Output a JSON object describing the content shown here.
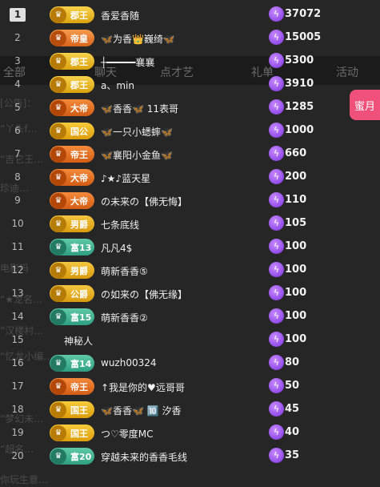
{
  "background": {
    "tabs": [
      "全部",
      "聊天",
      "点才艺",
      "礼单",
      "活动"
    ],
    "side_button": "蜜月",
    "faded_lines": [
      "[公告]：",
      "“丫头f…",
      "“吉它王…",
      "珍迪…",
      "电影吗",
      "“★龙名…",
      "“汉楼村…",
      "“忆龙小编…",
      "“梦幻未…",
      "“超名…",
      "你玩生意…"
    ]
  },
  "ranking": [
    {
      "rank": "1",
      "tier": "郡王",
      "tier_class": "t-junwang",
      "name": "香爱香随",
      "score": "37072"
    },
    {
      "rank": "2",
      "tier": "帝皇",
      "tier_class": "t-diwang",
      "name": "🦋为香👑巍绮🦋",
      "score": "15005"
    },
    {
      "rank": "3",
      "tier": "郡王",
      "tier_class": "t-junwang",
      "name": "┼━━━━━襄襄",
      "score": "5300"
    },
    {
      "rank": "4",
      "tier": "郡王",
      "tier_class": "t-junwang",
      "name": "a、min",
      "score": "3910"
    },
    {
      "rank": "5",
      "tier": "大帝",
      "tier_class": "t-dadi",
      "name": "🦋香香🦋 11表哥",
      "score": "1285"
    },
    {
      "rank": "6",
      "tier": "国公",
      "tier_class": "t-guowang",
      "name": "🦋一只小蟋蟀🦋",
      "score": "1000"
    },
    {
      "rank": "7",
      "tier": "帝王",
      "tier_class": "t-dadi",
      "name": "🦋襄阳小金鱼🦋",
      "score": "660"
    },
    {
      "rank": "8",
      "tier": "大帝",
      "tier_class": "t-dadi",
      "name": "♪★♪蓝天星",
      "score": "200"
    },
    {
      "rank": "9",
      "tier": "大帝",
      "tier_class": "t-dadi",
      "name": "の未来の【佛无悔】",
      "score": "110"
    },
    {
      "rank": "10",
      "tier": "男爵",
      "tier_class": "t-gongjue",
      "name": "七条底线",
      "score": "105"
    },
    {
      "rank": "11",
      "tier": "富13",
      "tier_class": "t-fu",
      "name": "凡凡4$",
      "score": "100"
    },
    {
      "rank": "12",
      "tier": "男爵",
      "tier_class": "t-gongjue",
      "name": "萌新香香⑤",
      "score": "100"
    },
    {
      "rank": "13",
      "tier": "公爵",
      "tier_class": "t-gongjue",
      "name": "の如来の【佛无缘】",
      "score": "100"
    },
    {
      "rank": "14",
      "tier": "富15",
      "tier_class": "t-fu",
      "name": "萌新香香②",
      "score": "100"
    },
    {
      "rank": "15",
      "tier": "",
      "tier_class": "",
      "name": "神秘人",
      "score": "100"
    },
    {
      "rank": "16",
      "tier": "富14",
      "tier_class": "t-fu",
      "name": "wuzh00324",
      "score": "80"
    },
    {
      "rank": "17",
      "tier": "帝王",
      "tier_class": "t-dadi",
      "name": "↑我是你的♥远哥哥",
      "score": "50"
    },
    {
      "rank": "18",
      "tier": "国王",
      "tier_class": "t-guowang",
      "name": "🦋香香🦋 🔟 汐香",
      "score": "45"
    },
    {
      "rank": "19",
      "tier": "国王",
      "tier_class": "t-guowang",
      "name": "つ♡零度MC",
      "score": "40"
    },
    {
      "rank": "20",
      "tier": "富20",
      "tier_class": "t-fu",
      "name": "穿越未来的香香毛线",
      "score": "35"
    }
  ],
  "icons": {
    "score": "lightning-icon",
    "badge": "crown-icon",
    "mystery": "incognito-icon"
  },
  "colors": {
    "background": "#262626",
    "score_icon": "#8a3cf0",
    "side_button": "#f0517b"
  }
}
